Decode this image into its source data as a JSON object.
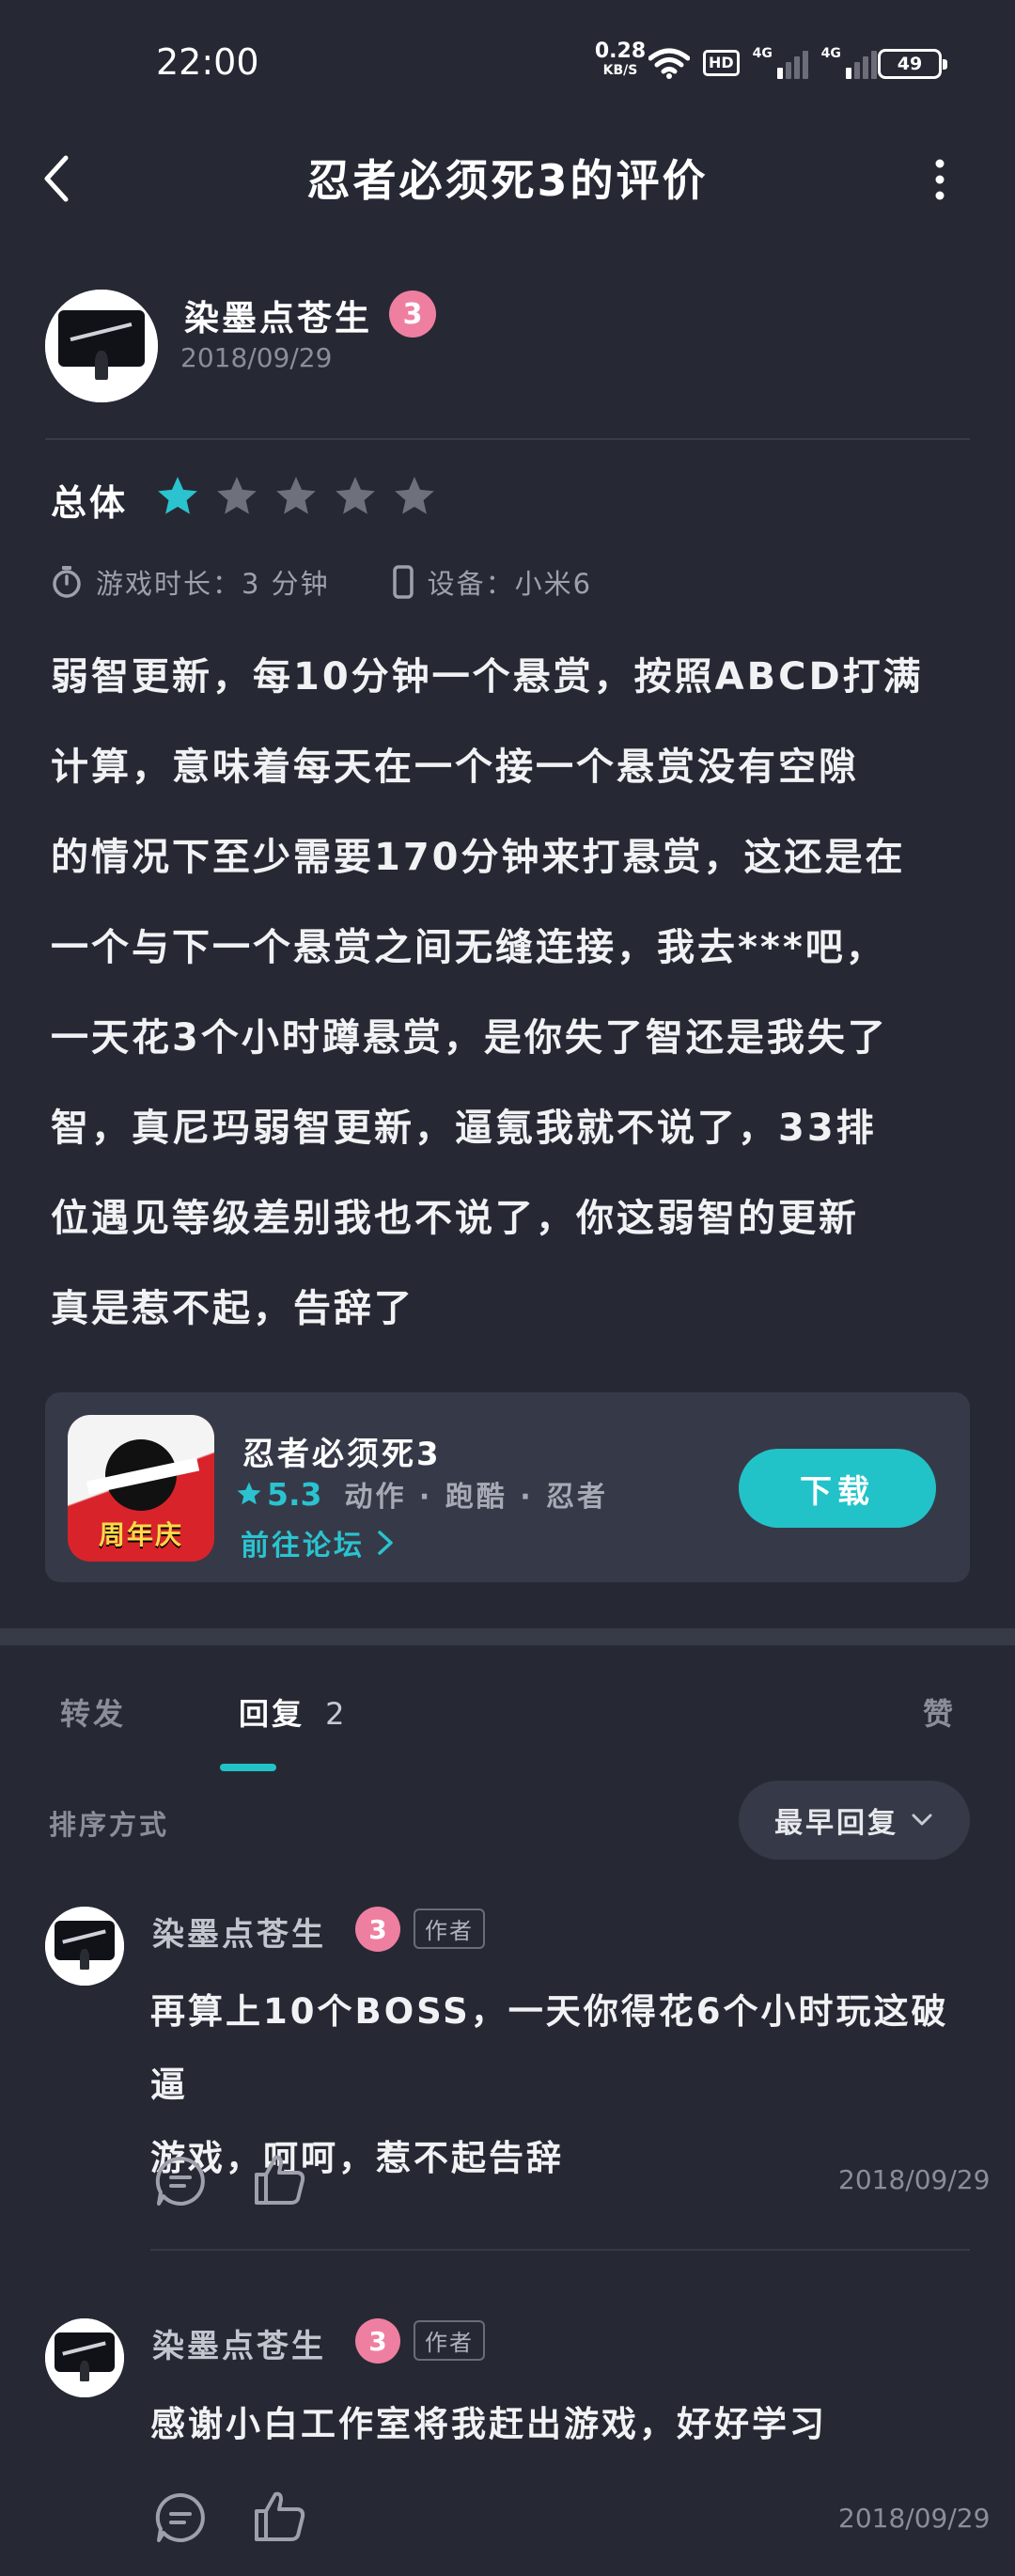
{
  "status_bar": {
    "time": "22:00",
    "net_speed_value": "0.28",
    "net_speed_unit": "KB/S",
    "hd_label": "HD",
    "signal_1_label": "4G",
    "signal_2_label": "4G",
    "battery": "49"
  },
  "header": {
    "title": "忍者必须死3的评价"
  },
  "review": {
    "author": "染墨点苍生",
    "level": "3",
    "date": "2018/09/29",
    "overall_label": "总体",
    "rating": 1,
    "max_rating": 5,
    "play_time": "游戏时长：3 分钟",
    "device": "设备：小米6",
    "lines": [
      "弱智更新，每10分钟一个悬赏，按照ABCD打满",
      "计算，意味着每天在一个接一个悬赏没有空隙",
      "的情况下至少需要170分钟来打悬赏，这还是在",
      "一个与下一个悬赏之间无缝连接，我去***吧，",
      "一天花3个小时蹲悬赏，是你失了智还是我失了",
      "智，真尼玛弱智更新，逼氪我就不说了，33排",
      "位遇见等级差别我也不说了，你这弱智的更新",
      "真是惹不起，告辞了"
    ]
  },
  "game_card": {
    "icon_label": "周年庆",
    "name": "忍者必须死3",
    "rating": "5.3",
    "tags": "动作 · 跑酷 · 忍者",
    "forum_link": "前往论坛",
    "download_label": "下载"
  },
  "tabs": {
    "forward": "转发",
    "reply": "回复",
    "reply_count": "2",
    "like": "赞"
  },
  "sort": {
    "label": "排序方式",
    "selected": "最早回复"
  },
  "replies": [
    {
      "author": "染墨点苍生",
      "level": "3",
      "author_tag": "作者",
      "lines": [
        "再算上10个BOSS，一天你得花6个小时玩这破逼",
        "游戏，呵呵，惹不起告辞"
      ],
      "date": "2018/09/29"
    },
    {
      "author": "染墨点苍生",
      "level": "3",
      "author_tag": "作者",
      "lines": [
        "感谢小白工作室将我赶出游戏，好好学习"
      ],
      "date": "2018/09/29"
    }
  ],
  "colors": {
    "background": "#262934",
    "accent": "#22c2c9",
    "star_active": "#2ac3cf",
    "star_inactive": "#6e717b",
    "level_badge": "#ef7fa0"
  }
}
